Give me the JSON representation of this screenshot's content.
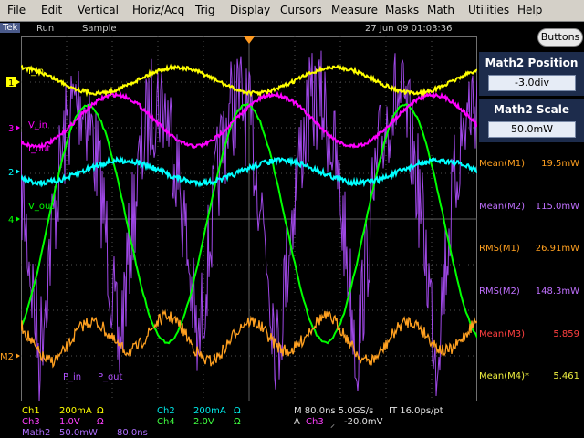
{
  "menu": [
    "File",
    "Edit",
    "Vertical",
    "Horiz/Acq",
    "Trig",
    "Display",
    "Cursors",
    "Measure",
    "Masks",
    "Math",
    "Utilities",
    "Help"
  ],
  "status": {
    "brand": "Tek",
    "run": "Run",
    "mode": "Sample",
    "datetime": "27 Jun 09 01:03:36"
  },
  "panel": {
    "buttons_label": "Buttons",
    "position": {
      "title": "Math2 Position",
      "value": "-3.0div"
    },
    "scale": {
      "title": "Math2 Scale",
      "value": "50.0mW"
    },
    "measurements": [
      {
        "label": "Mean(M1)",
        "value": "19.5mW",
        "color": "#ffa020"
      },
      {
        "label": "Mean(M2)",
        "value": "115.0mW",
        "color": "#c070ff"
      },
      {
        "label": "RMS(M1)",
        "value": "26.91mW",
        "color": "#ffa020"
      },
      {
        "label": "RMS(M2)",
        "value": "148.3mW",
        "color": "#c070ff"
      },
      {
        "label": "Mean(M3)",
        "value": "5.859",
        "color": "#ff4040"
      },
      {
        "label": "Mean(M4)*",
        "value": "5.461",
        "color": "#f0f040"
      }
    ]
  },
  "waveform_labels": {
    "i_in": "I_in",
    "v_in": "V_in",
    "i_out": "I_out",
    "v_out": "V_out",
    "p_in": "P_in",
    "p_out": "P_out"
  },
  "markers": {
    "ch1": "1",
    "ch3": "3",
    "ch2": "2",
    "ch4": "4",
    "m2": "M2"
  },
  "bottom": {
    "ch1": "Ch1",
    "ch1_scale": "200mA",
    "ch1_unit": "Ω",
    "ch3": "Ch3",
    "ch3_scale": "1.0V",
    "ch3_unit": "Ω",
    "math2": "Math2",
    "math2_scale": "50.0mW",
    "math2_time": "80.0ns",
    "ch2": "Ch2",
    "ch2_scale": "200mA",
    "ch2_unit": "Ω",
    "ch4": "Ch4",
    "ch4_scale": "2.0V",
    "ch4_unit": "Ω",
    "timebase": "M 80.0ns 5.0GS/s",
    "interval": "IT 16.0ps/pt",
    "trig_a": "A",
    "trig_ch": "Ch3",
    "trig_slope": "⸝",
    "trig_level": "-20.0mV"
  },
  "colors": {
    "ch1": "#ffff00",
    "ch2": "#00ffff",
    "ch3": "#ff00ff",
    "ch4": "#00ff00",
    "math1": "#ffa020",
    "math2": "#b050ff",
    "grid": "#505050"
  }
}
